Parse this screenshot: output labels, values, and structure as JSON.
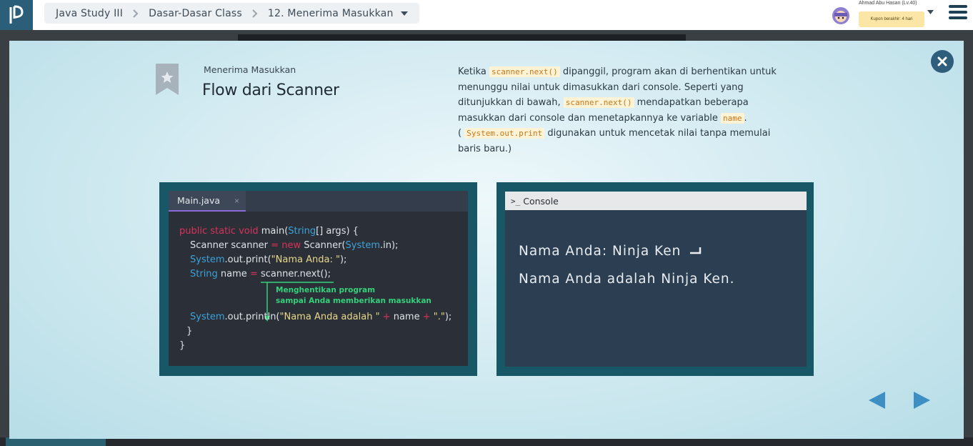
{
  "breadcrumb": {
    "items": [
      "Java Study III",
      "Dasar-Dasar Class",
      "12. Menerima Masukkan"
    ]
  },
  "user": {
    "name": "Ahmad Abu Hasan (Lv.40)",
    "coupon": "Kupon berakhir: 4 hari"
  },
  "lesson": {
    "subtitle": "Menerima Masukkan",
    "title": "Flow dari Scanner"
  },
  "description": {
    "t1": "Ketika ",
    "c1": "scanner.next()",
    "t2": " dipanggil, program akan di berhentikan untuk menunggu nilai untuk dimasukkan dari console. Seperti yang ditunjukkan di bawah, ",
    "c2": "scanner.next()",
    "t3": " mendapatkan beberapa masukkan dari console dan menetapkannya ke variable ",
    "c3": "name",
    "t4": ".",
    "t5": "( ",
    "c4": "System.out.print",
    "t6": " digunakan untuk mencetak nilai tanpa memulai baris baru.)"
  },
  "editor": {
    "tab_label": "Main.java",
    "tab_close": "×",
    "lines": {
      "l1": {
        "a": "public static void",
        "b": " main(",
        "c": "String",
        "d": "[] args) {"
      },
      "l2": {
        "a": "Scanner scanner ",
        "b": "=",
        "c": " new",
        "d": " Scanner(",
        "e": "System",
        "f": ".in);"
      },
      "l3": {
        "a": "System",
        "b": ".out.print(",
        "c": "\"Nama Anda: \"",
        "d": ");"
      },
      "l4": {
        "a": "String",
        "b": " name ",
        "c": "=",
        "d": " scanner.next();"
      },
      "l5": {
        "a": "System",
        "b": ".out.println(",
        "c": "\"Nama Anda adalah \"",
        "d": " + ",
        "e": "name",
        "f": " + ",
        "g": "\".\"",
        "h": ");"
      },
      "l6": "}",
      "l7": "}"
    },
    "note_line1": "Menghentikan program",
    "note_line2": "sampai Anda memberikan masukkan"
  },
  "console": {
    "title": "Console",
    "prompt_glyph": ">_",
    "line1": "Nama Anda: Ninja Ken",
    "line2": "Nama Anda adalah Ninja Ken."
  },
  "colors": {
    "accent": "#2b5f79",
    "panel_frame": "#175766",
    "keyword": "#d8335a",
    "type": "#3fa2d8",
    "note": "#35d07a",
    "nav_arrow": "#3d8fc4"
  },
  "icons": {
    "logo": "progate-logo-icon",
    "close": "close-icon",
    "bookmark": "bookmark-star-icon",
    "prev": "prev-arrow-icon",
    "next": "next-arrow-icon",
    "menu": "hamburger-menu-icon",
    "enter": "enter-key-icon"
  }
}
